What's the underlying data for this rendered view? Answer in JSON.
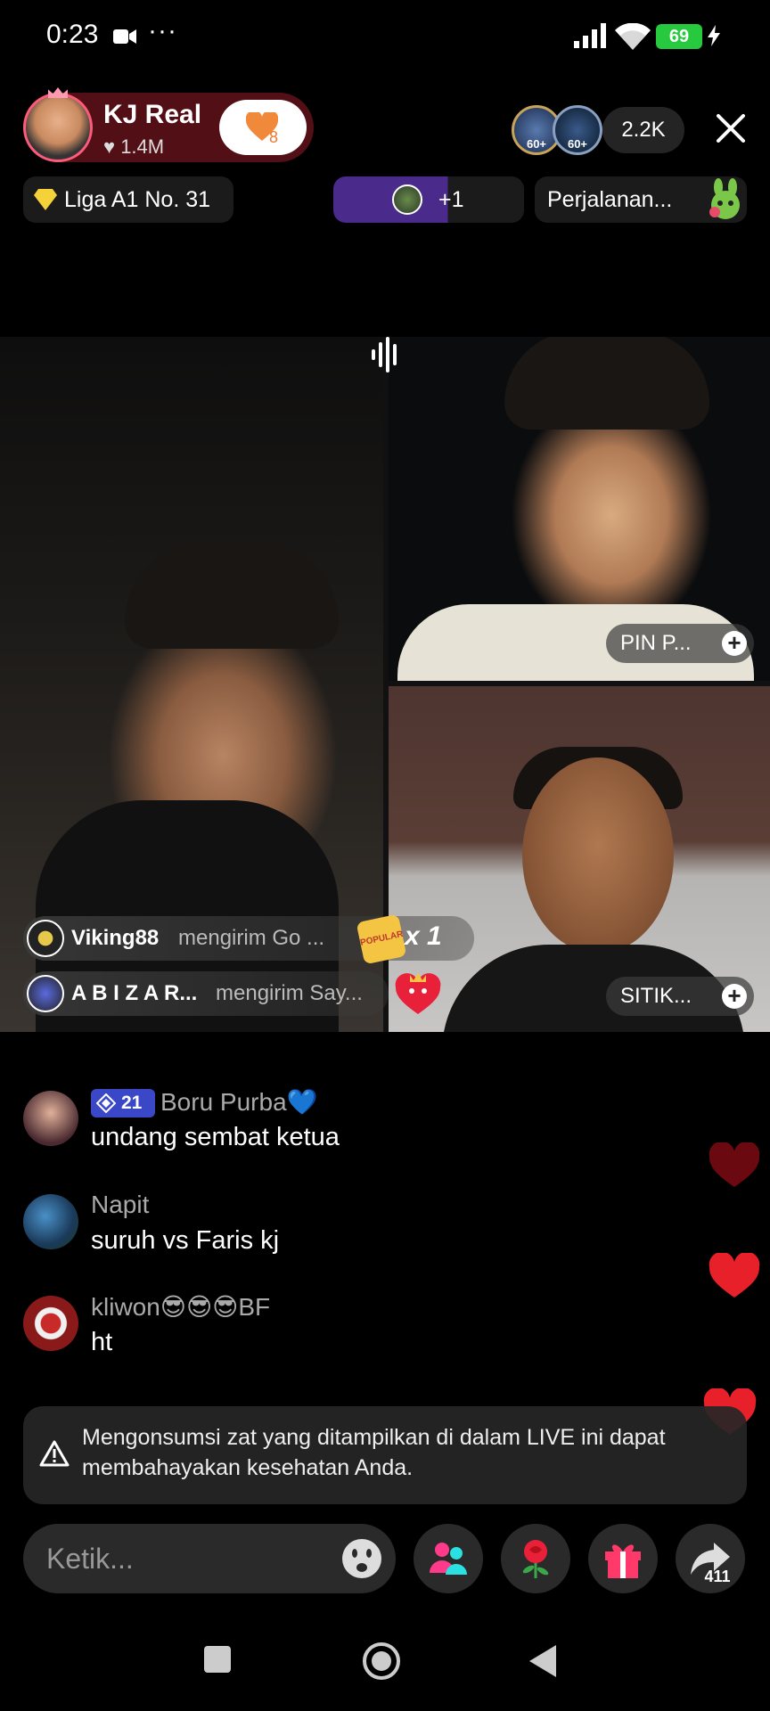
{
  "status_bar": {
    "time": "0:23",
    "battery": "69"
  },
  "host": {
    "name": "KJ Real",
    "likes": "1.4M",
    "follow_count": "8"
  },
  "viewers": {
    "badge1": "60+",
    "badge2": "60+",
    "count": "2.2K"
  },
  "chips": {
    "league": "Liga A1 No. 31",
    "plus": "+1",
    "journey": "Perjalanan..."
  },
  "guests": [
    {
      "label": "PIN P..."
    },
    {
      "label": "SITIK..."
    }
  ],
  "gift_messages": [
    {
      "user": "Viking88",
      "text": "mengirim Go ...",
      "multiplier": "x 1",
      "gift_label": "POPULAR"
    },
    {
      "user": "A B I Z A R...",
      "text": "mengirim Say..."
    }
  ],
  "comments": [
    {
      "level": "21",
      "user": "Boru Purba💙",
      "text": "undang sembat ketua"
    },
    {
      "user": "Napit",
      "text": "suruh vs Faris kj"
    },
    {
      "user": "kliwon😎😎😎BF",
      "text": "ht"
    }
  ],
  "warning": "Mengonsumsi zat yang ditampilkan di dalam LIVE ini dapat membahayakan kesehatan Anda.",
  "input": {
    "placeholder": "Ketik..."
  },
  "share": {
    "count": "411"
  },
  "colors": {
    "accent_red": "#e8202a",
    "follow_heart": "#f08a3a",
    "battery_green": "#27c93f",
    "level_badge": "#3a48c8"
  }
}
